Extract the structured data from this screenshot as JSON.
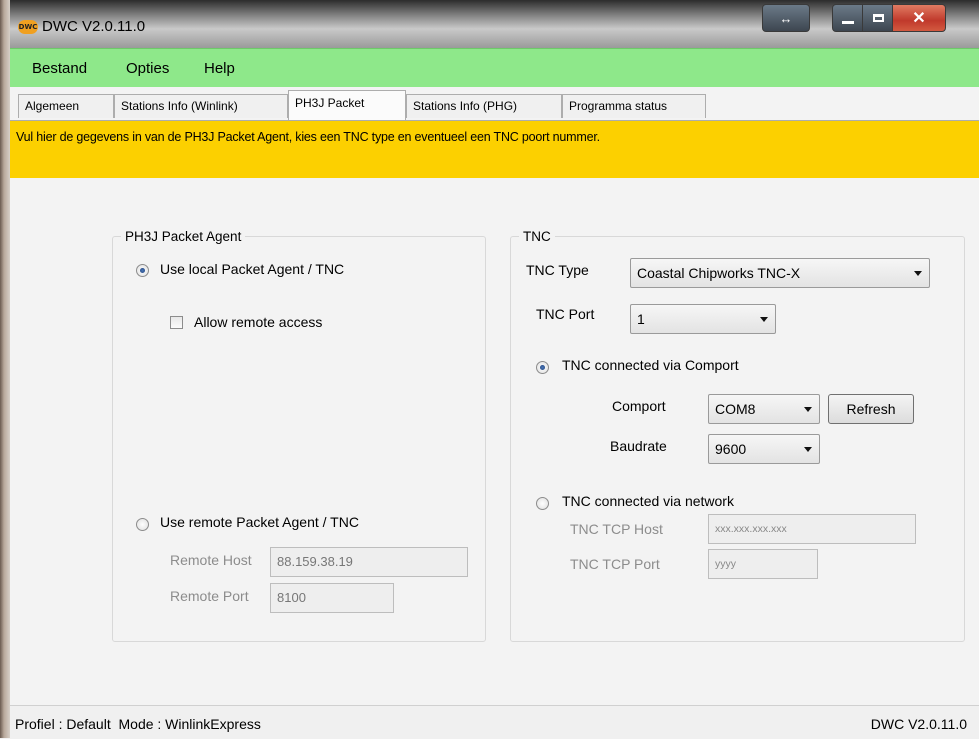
{
  "window": {
    "title": "DWC V2.0.11.0",
    "logo_text": "DWC",
    "controls": [
      "swap",
      "minimize",
      "maximize",
      "close"
    ]
  },
  "menu": {
    "items": [
      "Bestand",
      "Opties",
      "Help"
    ]
  },
  "tabs": {
    "items": [
      "Algemeen",
      "Stations Info (Winlink)",
      "PH3J Packet",
      "Stations Info (PHG)",
      "Programma status"
    ],
    "active": "PH3J Packet"
  },
  "banner": {
    "text": "Vul hier de gegevens in van de PH3J Packet Agent, kies een TNC type en eventueel een TNC poort nummer.",
    "color": "#fcd000"
  },
  "packet_agent": {
    "legend": "PH3J Packet Agent",
    "local_label": "Use local Packet Agent / TNC",
    "local_selected": true,
    "allow_remote_label": "Allow remote access",
    "allow_remote_checked": false,
    "remote_label": "Use remote Packet Agent / TNC",
    "remote_host_label": "Remote Host",
    "remote_host_value": "88.159.38.19",
    "remote_port_label": "Remote Port",
    "remote_port_value": "8100"
  },
  "tnc": {
    "legend": "TNC",
    "type_label": "TNC Type",
    "type_value": "Coastal Chipworks TNC-X",
    "port_label": "TNC Port",
    "port_value": "1",
    "comport_radio_label": "TNC connected via Comport",
    "comport_selected": true,
    "comport_label": "Comport",
    "comport_value": "COM8",
    "refresh_label": "Refresh",
    "baudrate_label": "Baudrate",
    "baudrate_value": "9600",
    "network_radio_label": "TNC connected via network",
    "tcp_host_label": "TNC TCP Host",
    "tcp_host_value": "xxx.xxx.xxx.xxx",
    "tcp_port_label": "TNC TCP Port",
    "tcp_port_value": "yyyy"
  },
  "status": {
    "left": "Profiel : Default  Mode : WinlinkExpress",
    "right": "DWC V2.0.11.0"
  },
  "colors": {
    "menubar": "#8ee88a",
    "banner": "#fcd000",
    "close_button": "#c0392b"
  }
}
